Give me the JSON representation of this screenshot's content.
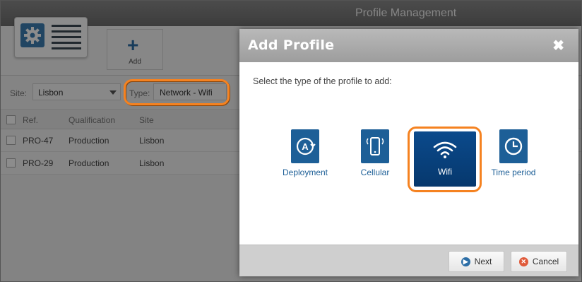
{
  "window": {
    "title": "Profile Management"
  },
  "toolbar": {
    "add_label": "Add"
  },
  "filters": {
    "site_label": "Site:",
    "site_value": "Lisbon",
    "type_label": "Type:",
    "type_value": "Network - Wifi"
  },
  "table": {
    "columns": [
      "Ref.",
      "Qualification",
      "Site"
    ],
    "rows": [
      {
        "ref": "PRO-47",
        "qualification": "Production",
        "site": "Lisbon"
      },
      {
        "ref": "PRO-29",
        "qualification": "Production",
        "site": "Lisbon"
      }
    ]
  },
  "modal": {
    "title": "Add Profile",
    "close_glyph": "✖",
    "prompt": "Select the type of the profile to add:",
    "options": [
      {
        "label": "Deployment",
        "icon": "deployment-icon",
        "selected": false
      },
      {
        "label": "Cellular",
        "icon": "cellular-icon",
        "selected": false
      },
      {
        "label": "Wifi",
        "icon": "wifi-icon",
        "selected": true
      },
      {
        "label": "Time period",
        "icon": "clock-icon",
        "selected": false
      }
    ],
    "buttons": {
      "next_label": "Next",
      "cancel_label": "Cancel"
    }
  },
  "colors": {
    "accent": "#1d5f97",
    "highlight": "#f58220",
    "next_icon": "#2c6ea6",
    "cancel_icon": "#e05a3a"
  }
}
